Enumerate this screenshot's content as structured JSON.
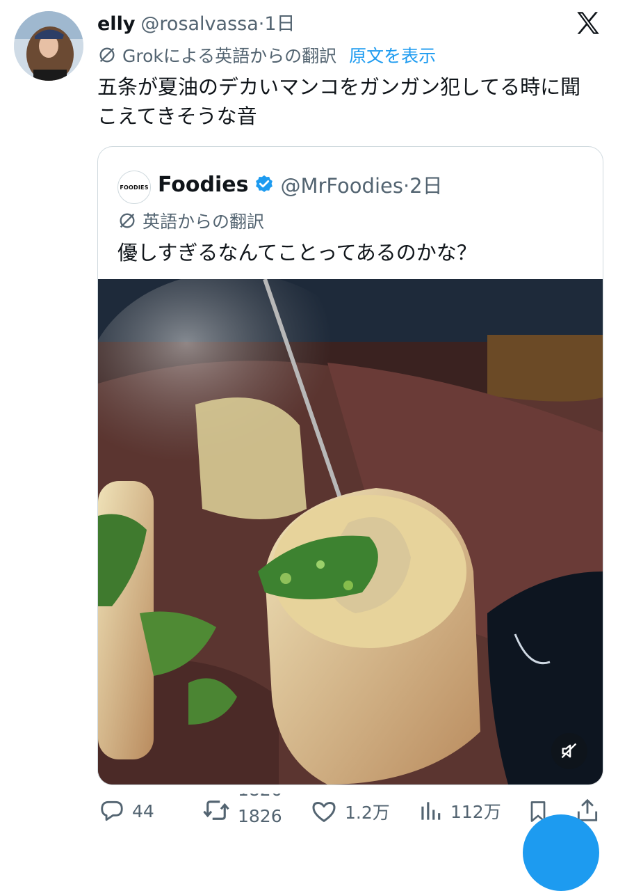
{
  "tweet": {
    "author_name": "elly",
    "handle_time": "@rosalvassa·1日",
    "translation_note": "Grokによる英語からの翻訳",
    "show_original": "原文を表示",
    "text": "五条が夏油のデカいマンコをガンガン犯してる時に聞こえてきそうな音"
  },
  "quote": {
    "avatar_text": "FOODIES",
    "author_name": "Foodies",
    "handle_time": "@MrFoodies·2日",
    "translation_note": "英語からの翻訳",
    "text": "優しすぎるなんてことってあるのかな？"
  },
  "actions": {
    "replies": "44",
    "retweets_previous": "1826",
    "retweets": "1826",
    "likes": "1.2万",
    "views": "112万"
  },
  "colors": {
    "accent": "#1d9bf0",
    "secondary_text": "#536471",
    "verified": "#1d9bf0"
  },
  "icons": {
    "close": "x-logo-icon",
    "translate": "slash-circle-icon",
    "reply": "reply-icon",
    "retweet": "retweet-icon",
    "like": "heart-icon",
    "views": "views-icon",
    "bookmark": "bookmark-icon",
    "share": "share-icon",
    "mute": "muted-speaker-icon"
  }
}
